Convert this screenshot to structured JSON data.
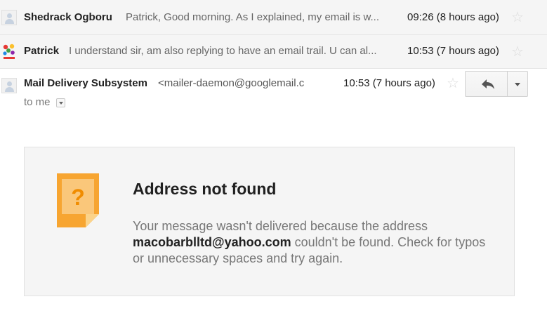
{
  "thread": [
    {
      "sender": "Shedrack Ogboru",
      "snippet": "Patrick, Good morning. As I explained, my email is w...",
      "time": "09:26 (8 hours ago)"
    },
    {
      "sender": "Patrick",
      "snippet": "I understand sir, am also replying to have an email trail. U can al...",
      "time": "10:53 (7 hours ago)"
    }
  ],
  "open_message": {
    "sender": "Mail Delivery Subsystem",
    "address": "<mailer-daemon@googlemail.c",
    "time": "10:53 (7 hours ago)",
    "to": "to me"
  },
  "bounce": {
    "title": "Address not found",
    "body_pre": "Your message wasn't delivered because the address",
    "address": "macobarblltd@yahoo.com",
    "body_post": "couldn't be found. Check for typos or unnecessary spaces and try again.",
    "icon_glyph": "?"
  },
  "icons": {
    "star": "star-icon",
    "reply": "reply-icon",
    "more": "chevron-down-icon",
    "note": "question-note-icon"
  },
  "colors": {
    "note_orange": "#f7a531",
    "note_fold": "#f9c66b"
  }
}
